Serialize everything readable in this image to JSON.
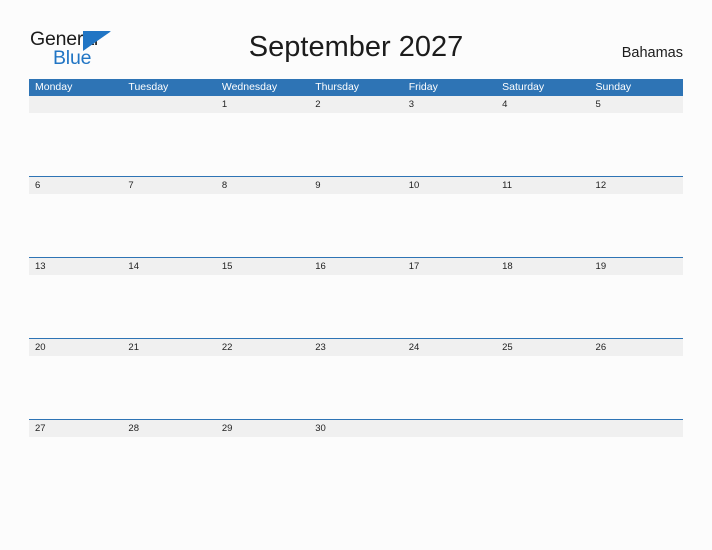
{
  "brand": {
    "name_part1": "General",
    "name_part2": "Blue",
    "flag_icon": "blue-triangle-flag-icon",
    "color_dark": "#1b1b1b",
    "color_blue": "#2175c4"
  },
  "header": {
    "title": "September 2027",
    "country": "Bahamas"
  },
  "colors": {
    "header_blue": "#2e74b5",
    "row_rule_blue": "#2e74b5",
    "day_band_gray": "#f0f0f0",
    "page_background": "#fcfcfc",
    "text": "#1c1c1c"
  },
  "calendar": {
    "month": "September",
    "year": "2027",
    "weekday_headers": [
      "Monday",
      "Tuesday",
      "Wednesday",
      "Thursday",
      "Friday",
      "Saturday",
      "Sunday"
    ],
    "weeks": [
      {
        "days": [
          "",
          "",
          "1",
          "2",
          "3",
          "4",
          "5"
        ]
      },
      {
        "days": [
          "6",
          "7",
          "8",
          "9",
          "10",
          "11",
          "12"
        ]
      },
      {
        "days": [
          "13",
          "14",
          "15",
          "16",
          "17",
          "18",
          "19"
        ]
      },
      {
        "days": [
          "20",
          "21",
          "22",
          "23",
          "24",
          "25",
          "26"
        ]
      },
      {
        "days": [
          "27",
          "28",
          "29",
          "30",
          "",
          "",
          ""
        ]
      }
    ]
  }
}
